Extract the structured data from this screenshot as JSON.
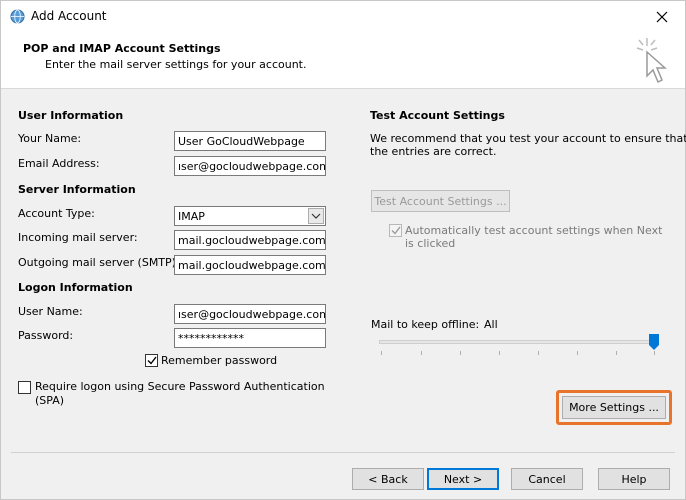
{
  "window": {
    "title": "Add Account"
  },
  "header": {
    "title": "POP and IMAP Account Settings",
    "subtitle": "Enter the mail server settings for your account."
  },
  "user_info": {
    "section": "User Information",
    "name_label": "Your Name:",
    "name_value": "User GoCloudWebpage",
    "email_label": "Email Address:",
    "email_value": "ıser@gocloudwebpage.com"
  },
  "server_info": {
    "section": "Server Information",
    "account_type_label": "Account Type:",
    "account_type_value": "IMAP",
    "incoming_label": "Incoming mail server:",
    "incoming_value": "mail.gocloudwebpage.com",
    "outgoing_label": "Outgoing mail server (SMTP):",
    "outgoing_value": "mail.gocloudwebpage.com"
  },
  "logon_info": {
    "section": "Logon Information",
    "username_label": "User Name:",
    "username_value": "ıser@gocloudwebpage.com",
    "password_label": "Password:",
    "password_value": "************",
    "remember_label": "Remember password",
    "remember_checked": true,
    "spa_label_line1": "Require logon using Secure Password Authentication",
    "spa_label_line2": "(SPA)",
    "spa_checked": false
  },
  "test_settings": {
    "section": "Test Account Settings",
    "desc_line1": "We recommend that you test your account to ensure that",
    "desc_line2": "the entries are correct.",
    "test_button": "Test Account Settings ...",
    "auto_test_line1": "Automatically test account settings when Next",
    "auto_test_line2": "is clicked",
    "auto_test_checked": true
  },
  "offline": {
    "label": "Mail to keep offline:",
    "value": "All",
    "slider_level": 1.0
  },
  "buttons": {
    "more_settings": "More Settings ...",
    "back": "< Back",
    "next": "Next >",
    "cancel": "Cancel",
    "help": "Help"
  },
  "colors": {
    "highlight": "#e8742b",
    "accent": "#0078d7"
  }
}
